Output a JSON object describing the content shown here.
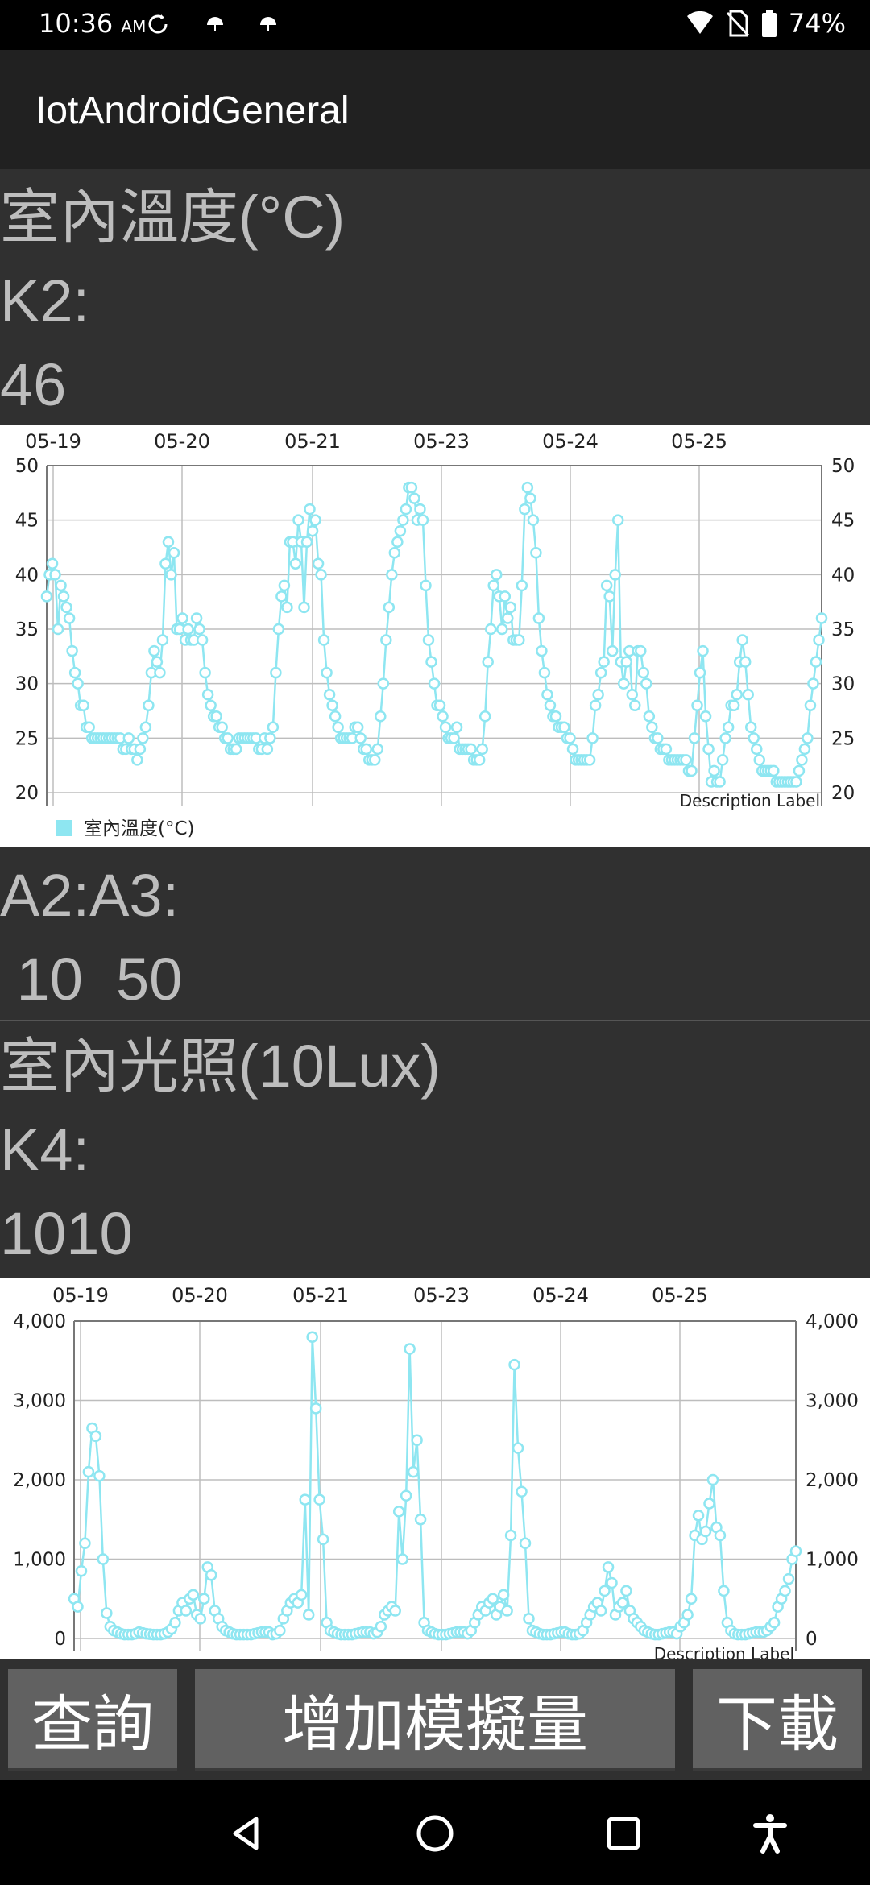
{
  "status_bar": {
    "time": "10:36",
    "ampm": "AM",
    "battery": "74%"
  },
  "app": {
    "title": "IotAndroidGeneral"
  },
  "temperature": {
    "title": "室內溫度(°C)",
    "key_label": "K2:",
    "value": "46"
  },
  "range": {
    "label": "A2:A3:",
    "value": " 10  50"
  },
  "light": {
    "title": "室內光照(10Lux)",
    "key_label": "K4:",
    "value": "1010"
  },
  "buttons": {
    "query": "查詢",
    "add": "增加模擬量",
    "download": "下載"
  },
  "colors": {
    "series": "#8ee6f1",
    "app_bg": "#303030",
    "actionbar": "#212121"
  },
  "icons": {
    "back": "back-icon",
    "home": "home-icon",
    "recents": "recents-icon",
    "accessibility": "accessibility-icon"
  },
  "chart_data": [
    {
      "type": "line",
      "top_tick_labels": [
        "05-19",
        "05-20",
        "05-21",
        "05-23",
        "05-24",
        "05-25"
      ],
      "ylim": [
        20,
        50
      ],
      "y_ticks": [
        "20",
        "25",
        "30",
        "35",
        "40",
        "45",
        "50"
      ],
      "description": "Description Label",
      "grid": true,
      "legend": "bottom-left",
      "series": [
        {
          "name": "室內溫度(°C)",
          "values": [
            38,
            40,
            41,
            40,
            35,
            39,
            38,
            37,
            36,
            33,
            31,
            30,
            28,
            28,
            26,
            26,
            25,
            25,
            25,
            25,
            25,
            25,
            25,
            25,
            25,
            25,
            25,
            24,
            24,
            25,
            24,
            24,
            23,
            24,
            25,
            26,
            28,
            31,
            33,
            32,
            31,
            34,
            41,
            43,
            40,
            42,
            35,
            35,
            36,
            34,
            35,
            34,
            34,
            36,
            35,
            34,
            31,
            29,
            28,
            27,
            27,
            26,
            26,
            25,
            25,
            24,
            24,
            24,
            25,
            25,
            25,
            25,
            25,
            25,
            25,
            24,
            24,
            25,
            24,
            25,
            26,
            31,
            35,
            38,
            39,
            37,
            43,
            43,
            41,
            45,
            43,
            37,
            43,
            46,
            44,
            45,
            41,
            40,
            34,
            31,
            29,
            28,
            27,
            26,
            25,
            25,
            25,
            25,
            25,
            26,
            26,
            25,
            24,
            24,
            23,
            23,
            23,
            24,
            27,
            30,
            34,
            37,
            40,
            42,
            43,
            44,
            45,
            46,
            48,
            48,
            47,
            45,
            46,
            45,
            39,
            34,
            32,
            30,
            28,
            28,
            27,
            26,
            25,
            25,
            25,
            26,
            24,
            24,
            24,
            24,
            24,
            23,
            23,
            23,
            24,
            27,
            32,
            35,
            39,
            40,
            38,
            35,
            38,
            36,
            37,
            34,
            34,
            34,
            39,
            46,
            48,
            47,
            45,
            42,
            36,
            33,
            31,
            29,
            28,
            27,
            27,
            26,
            26,
            26,
            25,
            25,
            24,
            23,
            23,
            23,
            23,
            23,
            23,
            25,
            28,
            29,
            31,
            32,
            39,
            38,
            33,
            40,
            45,
            32,
            30,
            32,
            33,
            29,
            28,
            33,
            33,
            31,
            30,
            27,
            26,
            25,
            25,
            24,
            24,
            24,
            23,
            23,
            23,
            23,
            23,
            23,
            23,
            22,
            22,
            25,
            28,
            31,
            33,
            27,
            24,
            21,
            22,
            21,
            21,
            23,
            25,
            26,
            28,
            28,
            29,
            32,
            34,
            32,
            29,
            26,
            25,
            24,
            23,
            22,
            22,
            22,
            22,
            22,
            21,
            21,
            21,
            21,
            21,
            21,
            21,
            21,
            22,
            23,
            24,
            25,
            28,
            30,
            32,
            34,
            36
          ]
        }
      ]
    },
    {
      "type": "line",
      "top_tick_labels": [
        "05-19",
        "05-20",
        "05-21",
        "05-23",
        "05-24",
        "05-25"
      ],
      "ylim": [
        0,
        4000
      ],
      "y_ticks": [
        "0",
        "1,000",
        "2,000",
        "3,000",
        "4,000"
      ],
      "description": "Description Label",
      "grid": true,
      "series": [
        {
          "name": "",
          "values": [
            500,
            400,
            850,
            1200,
            2100,
            2650,
            2550,
            2050,
            1000,
            320,
            150,
            100,
            80,
            60,
            50,
            50,
            50,
            60,
            80,
            70,
            60,
            55,
            50,
            50,
            50,
            60,
            80,
            120,
            200,
            350,
            450,
            350,
            500,
            550,
            300,
            250,
            500,
            900,
            800,
            350,
            250,
            150,
            100,
            80,
            60,
            50,
            50,
            50,
            50,
            50,
            60,
            70,
            80,
            80,
            80,
            50,
            60,
            100,
            250,
            350,
            450,
            500,
            450,
            550,
            1750,
            300,
            3800,
            2900,
            1750,
            1250,
            200,
            100,
            80,
            60,
            50,
            50,
            50,
            50,
            60,
            70,
            80,
            80,
            80,
            60,
            80,
            150,
            300,
            350,
            400,
            350,
            1600,
            1000,
            1800,
            3650,
            2100,
            2500,
            1500,
            200,
            100,
            80,
            60,
            50,
            50,
            50,
            60,
            70,
            80,
            80,
            80,
            60,
            100,
            200,
            300,
            400,
            350,
            450,
            500,
            300,
            400,
            550,
            350,
            1300,
            3450,
            2400,
            1850,
            1200,
            250,
            100,
            80,
            60,
            50,
            50,
            50,
            60,
            70,
            80,
            80,
            60,
            50,
            50,
            60,
            100,
            200,
            300,
            400,
            450,
            350,
            600,
            900,
            700,
            300,
            400,
            450,
            600,
            350,
            250,
            200,
            150,
            100,
            80,
            60,
            50,
            50,
            60,
            70,
            80,
            80,
            60,
            150,
            200,
            300,
            500,
            1300,
            1550,
            1250,
            1350,
            1700,
            2000,
            1400,
            1300,
            600,
            200,
            100,
            60,
            50,
            50,
            50,
            60,
            70,
            80,
            80,
            80,
            100,
            150,
            200,
            400,
            500,
            600,
            750,
            1000,
            1100
          ]
        }
      ]
    }
  ]
}
